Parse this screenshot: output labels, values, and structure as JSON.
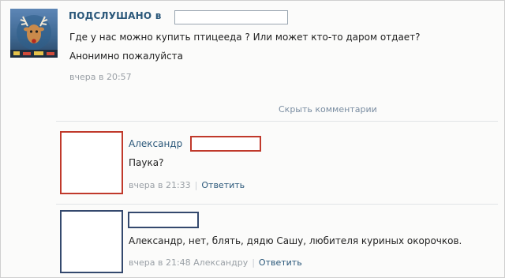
{
  "post": {
    "author": "ПОДСЛУШАНО в",
    "text_line1": "Где у нас можно купить птицееда ? Или может кто-то даром отдает?",
    "text_line2": "Анонимно пожалуйста",
    "time": "вчера в 20:57"
  },
  "comments_toggle": "Скрыть комментарии",
  "comments": [
    {
      "name": "Александр",
      "text": "Паука?",
      "time": "вчера в 21:33",
      "reply_label": "Ответить",
      "highlight_color": "#c0392b"
    },
    {
      "text": "Александр, нет, блять, дядю Сашу, любителя куриных окорочков.",
      "time": "вчера в 21:48",
      "addressee": "Александру",
      "reply_label": "Ответить",
      "highlight_color": "#34496e"
    }
  ],
  "colors": {
    "link": "#2b587a",
    "muted": "#9aa0a6",
    "text": "#222222"
  }
}
